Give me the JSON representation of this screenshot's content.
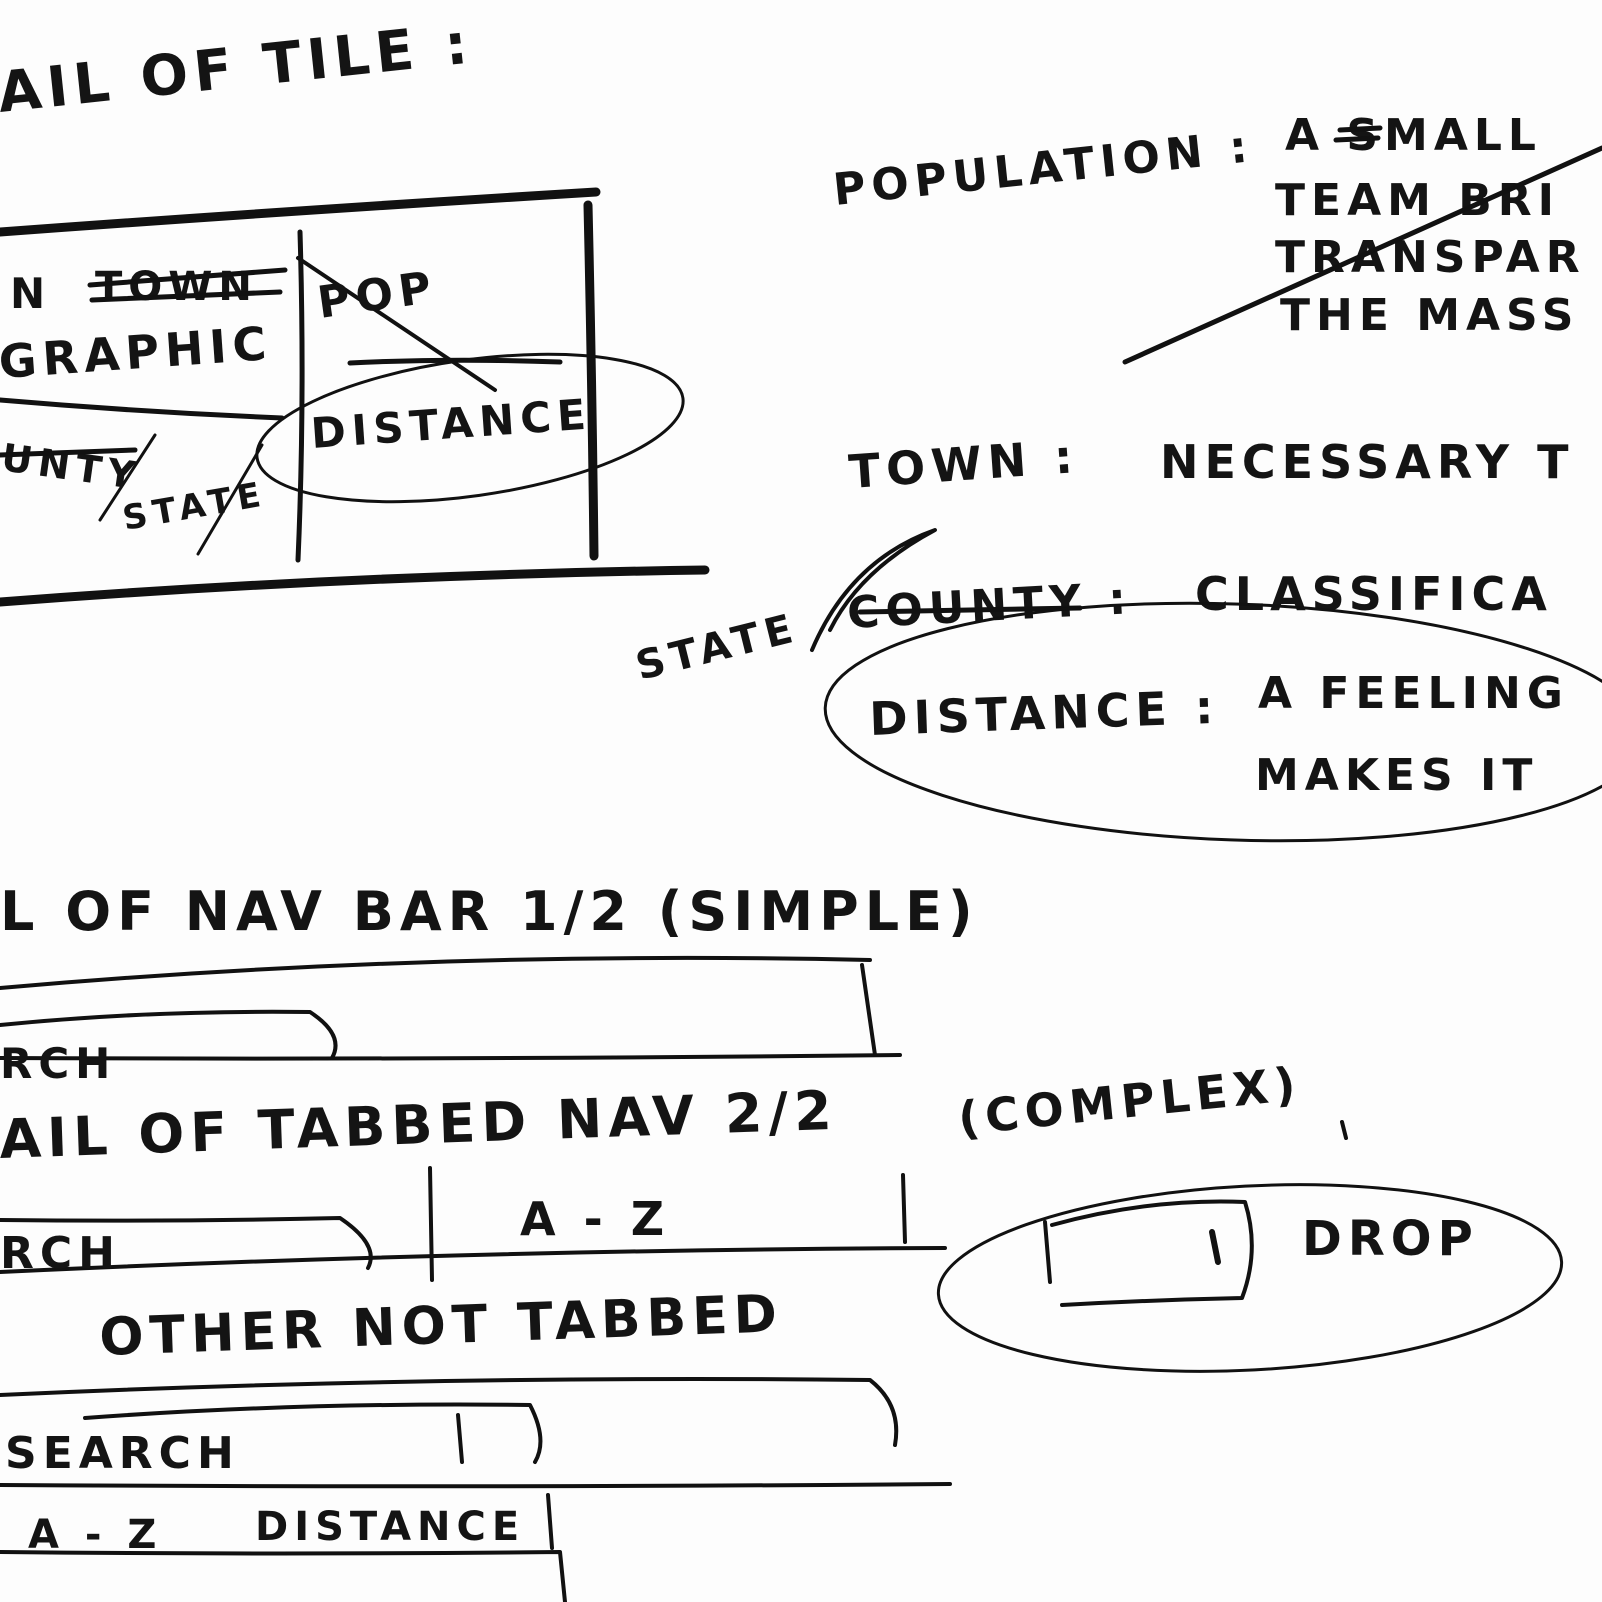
{
  "tile_heading": "AIL OF TILE :",
  "tile_box": {
    "town_label": "N",
    "crossed_word": "TOWN",
    "photo_label": "GRAPHIC",
    "pop_label": "POP",
    "county_label": "UNTY",
    "state_label": "STATE",
    "distance_label": "DISTANCE"
  },
  "notes": {
    "population_label": "POPULATION :",
    "population_lines": [
      "A SMALL",
      "TEAM BRI",
      "TRANSPAR",
      "THE MASS"
    ],
    "town_label": "TOWN :",
    "town_text": "NECESSARY T",
    "state_label": "STATE",
    "county_label": "COUNTY :",
    "county_text": "CLASSIFICA",
    "distance_label": "DISTANCE :",
    "distance_lines": [
      "A FEELING",
      "MAKES IT"
    ]
  },
  "navbar_heading": "L OF   NAV BAR  1/2  (SIMPLE)",
  "navbar_simple": {
    "search_label": "RCH"
  },
  "tabbed_heading": "AIL OF TABBED NAV 2/2",
  "tabbed_suffix": "(COMPLEX)",
  "tabbed_nav": {
    "search_label": "RCH",
    "az_tab": "A - Z",
    "drop_label": "DROP"
  },
  "other_heading": "OTHER  NOT  TABBED",
  "other_nav": {
    "search_label": "SEARCH",
    "az_tab": "A - Z",
    "distance_tab": "DISTANCE"
  }
}
